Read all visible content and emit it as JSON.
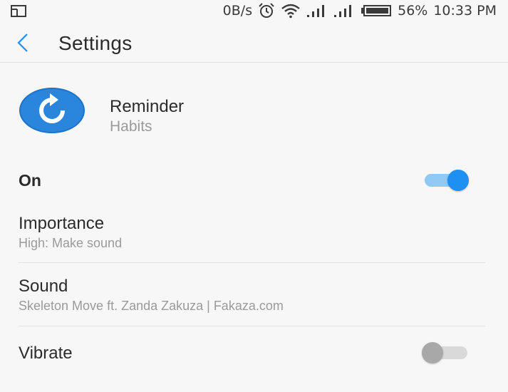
{
  "status_bar": {
    "net_speed": "0B/s",
    "battery_percent": "56%",
    "time": "10:33 PM",
    "icons": [
      "screen-icon",
      "alarm-icon",
      "wifi-icon",
      "signal-icon",
      "signal-icon",
      "battery-icon"
    ]
  },
  "app_bar": {
    "title": "Settings",
    "back_icon": "chevron-left-icon"
  },
  "app": {
    "name": "Reminder",
    "subtitle": "Habits",
    "icon": "refresh-icon"
  },
  "rows": {
    "on": {
      "label": "On",
      "checked": true
    },
    "importance": {
      "label": "Importance",
      "value": "High: Make sound"
    },
    "sound": {
      "label": "Sound",
      "value": "Skeleton Move ft. Zanda Zakuza | Fakaza.com"
    },
    "vibrate": {
      "label": "Vibrate",
      "checked": false
    }
  },
  "colors": {
    "accent": "#1e90f2",
    "accent_light": "#8fcaf7",
    "text_primary": "#2b2b2b",
    "text_secondary": "#9a9a9a",
    "background": "#f7f7f7"
  }
}
